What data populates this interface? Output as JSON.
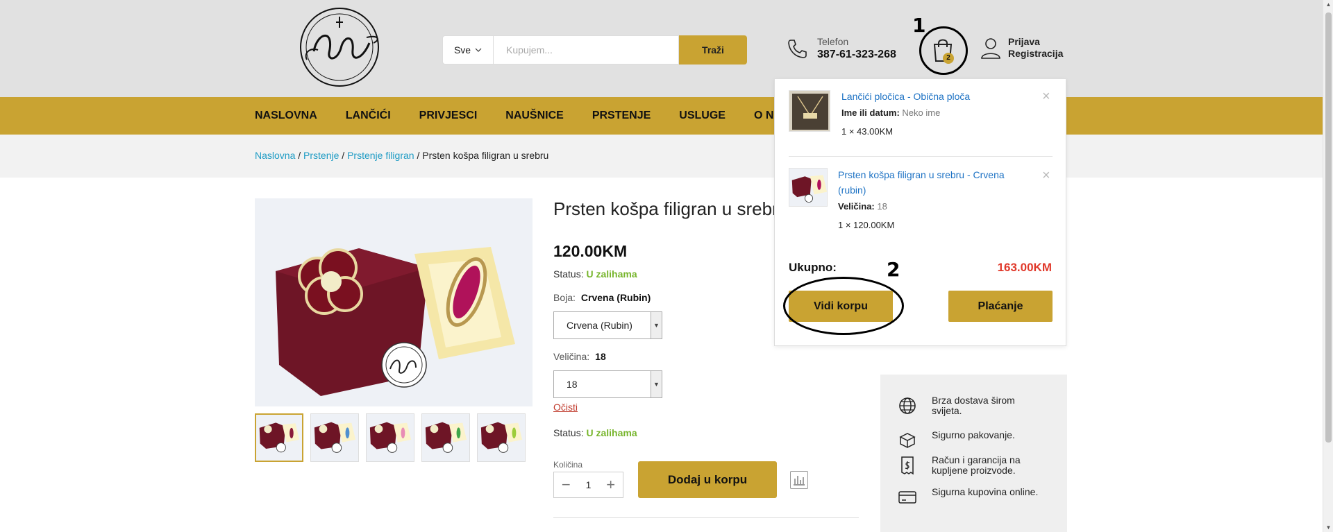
{
  "header": {
    "search": {
      "category": "Sve",
      "placeholder": "Kupujem...",
      "button": "Traži"
    },
    "phone": {
      "label": "Telefon",
      "number": "387-61-323-268"
    },
    "cart": {
      "count": "2"
    },
    "account": {
      "login": "Prijava",
      "register": "Registracija"
    },
    "annotations": {
      "one": "1",
      "two": "2"
    }
  },
  "nav": {
    "items": [
      "NASLOVNA",
      "LANČIĆI",
      "PRIVJESCI",
      "NAUŠNICE",
      "PRSTENJE",
      "USLUGE",
      "O NAMA"
    ]
  },
  "breadcrumb": {
    "items": [
      "Naslovna",
      "Prstenje",
      "Prstenje filigran"
    ],
    "current": "Prsten košpa filigran u srebru"
  },
  "product": {
    "title": "Prsten košpa filigran u srebru",
    "price": "120.00KM",
    "status_label": "Status:",
    "status_value": "U zalihama",
    "color_label": "Boja:",
    "color_value": "Crvena (Rubin)",
    "color_select": "Crvena (Rubin)",
    "size_label": "Veličina:",
    "size_value": "18",
    "size_select": "18",
    "clear": "Očisti",
    "status2_label": "Status:",
    "status2_value": "U zalihama",
    "qty_label": "Količina",
    "qty": "1",
    "add_to_cart": "Dodaj u korpu",
    "thumb_colors": [
      "#8a1a3a",
      "#4f8fd0",
      "#e88cb5",
      "#3fa64a",
      "#9ccc3a"
    ]
  },
  "side_info": {
    "items": [
      "Brza dostava širom svijeta.",
      "Sigurno pakovanje.",
      "Račun i garancija na kupljene proizvode.",
      "Sigurna kupovina online."
    ]
  },
  "minicart": {
    "items": [
      {
        "name": "Lančići pločica - Obična ploča",
        "meta_label": "Ime ili datum:",
        "meta_value": "Neko ime",
        "qty": "1 × 43.00KM"
      },
      {
        "name_line1": "Prsten košpa filigran u srebru - Crvena",
        "name_line2": "(rubin)",
        "meta_label": "Veličina:",
        "meta_value": "18",
        "qty": "1 × 120.00KM"
      }
    ],
    "total_label": "Ukupno:",
    "total_value": "163.00KM",
    "view_cart": "Vidi korpu",
    "checkout": "Plaćanje"
  },
  "colors": {
    "accent": "#c9a332",
    "link": "#1d9bc4",
    "in_stock": "#77b52c",
    "total": "#e0392b"
  }
}
